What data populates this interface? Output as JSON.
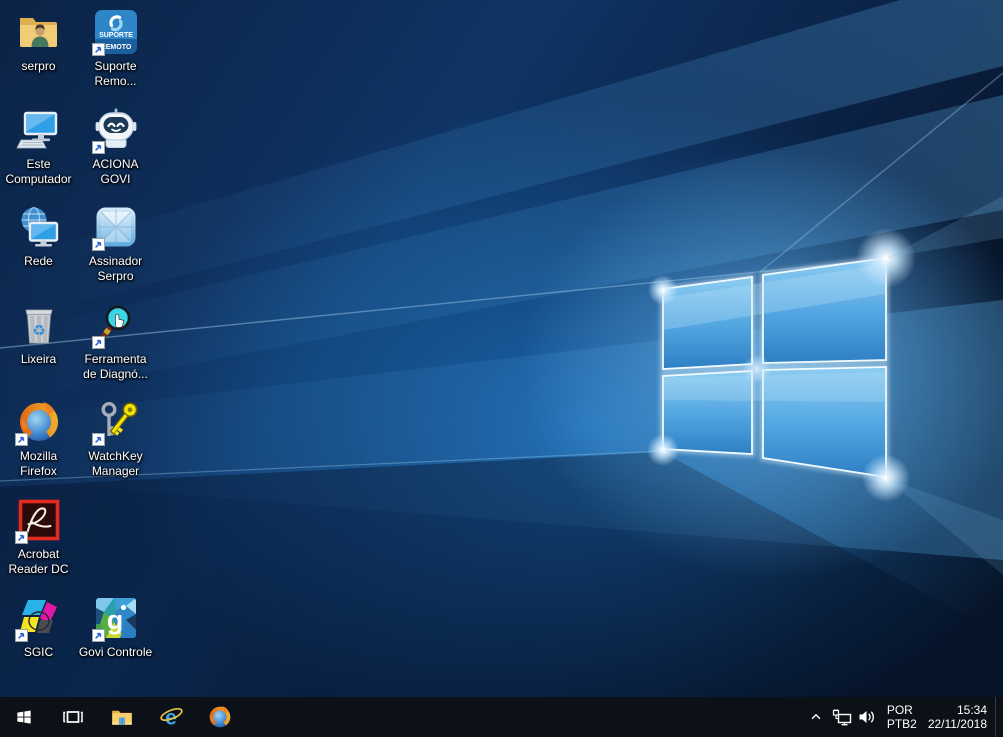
{
  "desktop": {
    "icons": [
      {
        "name": "serpro",
        "label": "serpro",
        "icon": "folder-user",
        "shortcut": false,
        "col": 0,
        "row": 0
      },
      {
        "name": "suporte-remoto",
        "label": "Suporte\nRemo...",
        "icon": "suporte-tile",
        "shortcut": true,
        "col": 1,
        "row": 0,
        "tile_lines": [
          "SUPORTE",
          "REMOTO"
        ]
      },
      {
        "name": "este-computador",
        "label": "Este\nComputador",
        "icon": "this-pc",
        "shortcut": false,
        "col": 0,
        "row": 1
      },
      {
        "name": "aciona-govi",
        "label": "ACIONA\nGOVI",
        "icon": "robot",
        "shortcut": true,
        "col": 1,
        "row": 1
      },
      {
        "name": "rede",
        "label": "Rede",
        "icon": "network-pc",
        "shortcut": false,
        "col": 0,
        "row": 2
      },
      {
        "name": "assinador-serpro",
        "label": "Assinador\nSerpro",
        "icon": "faceted-tile",
        "shortcut": true,
        "col": 1,
        "row": 2
      },
      {
        "name": "lixeira",
        "label": "Lixeira",
        "icon": "recycle-bin",
        "shortcut": false,
        "col": 0,
        "row": 3
      },
      {
        "name": "ferramenta-diagnostico",
        "label": "Ferramenta\nde Diagnó...",
        "icon": "magnifier-hand",
        "shortcut": true,
        "col": 1,
        "row": 3
      },
      {
        "name": "mozilla-firefox",
        "label": "Mozilla\nFirefox",
        "icon": "firefox",
        "shortcut": true,
        "col": 0,
        "row": 4
      },
      {
        "name": "watchkey-manager",
        "label": "WatchKey\nManager",
        "icon": "keys",
        "shortcut": true,
        "col": 1,
        "row": 4
      },
      {
        "name": "acrobat-reader-dc",
        "label": "Acrobat\nReader DC",
        "icon": "acrobat",
        "shortcut": true,
        "col": 0,
        "row": 5
      },
      {
        "name": "sgic",
        "label": "SGIC",
        "icon": "cmyk-shapes",
        "shortcut": true,
        "col": 0,
        "row": 6
      },
      {
        "name": "govi-controle",
        "label": "Govi Controle",
        "icon": "govi-tile",
        "shortcut": true,
        "col": 1,
        "row": 6,
        "letter": "g"
      }
    ]
  },
  "taskbar": {
    "items": [
      {
        "name": "start",
        "icon": "start"
      },
      {
        "name": "task-view",
        "icon": "task-view"
      },
      {
        "name": "file-explorer",
        "icon": "file-explorer"
      },
      {
        "name": "internet-explorer",
        "icon": "internet-explorer"
      },
      {
        "name": "firefox",
        "icon": "firefox-logo"
      }
    ],
    "tray_icons": [
      {
        "name": "hidden-icons",
        "icon": "chevron-up"
      },
      {
        "name": "network-status",
        "icon": "network-ethernet"
      },
      {
        "name": "volume",
        "icon": "speaker"
      }
    ],
    "language": {
      "line1": "POR",
      "line2": "PTB2"
    },
    "clock": {
      "time": "15:34",
      "date": "22/11/2018"
    }
  },
  "colors": {
    "taskbar_bg": "#0c1117",
    "wallpaper_base": "#0f3464",
    "wallpaper_dark": "#071326",
    "wallpaper_bright": "#1e78c8",
    "logo_fill": "#55a8e2",
    "logo_edge": "#f2fbff"
  }
}
